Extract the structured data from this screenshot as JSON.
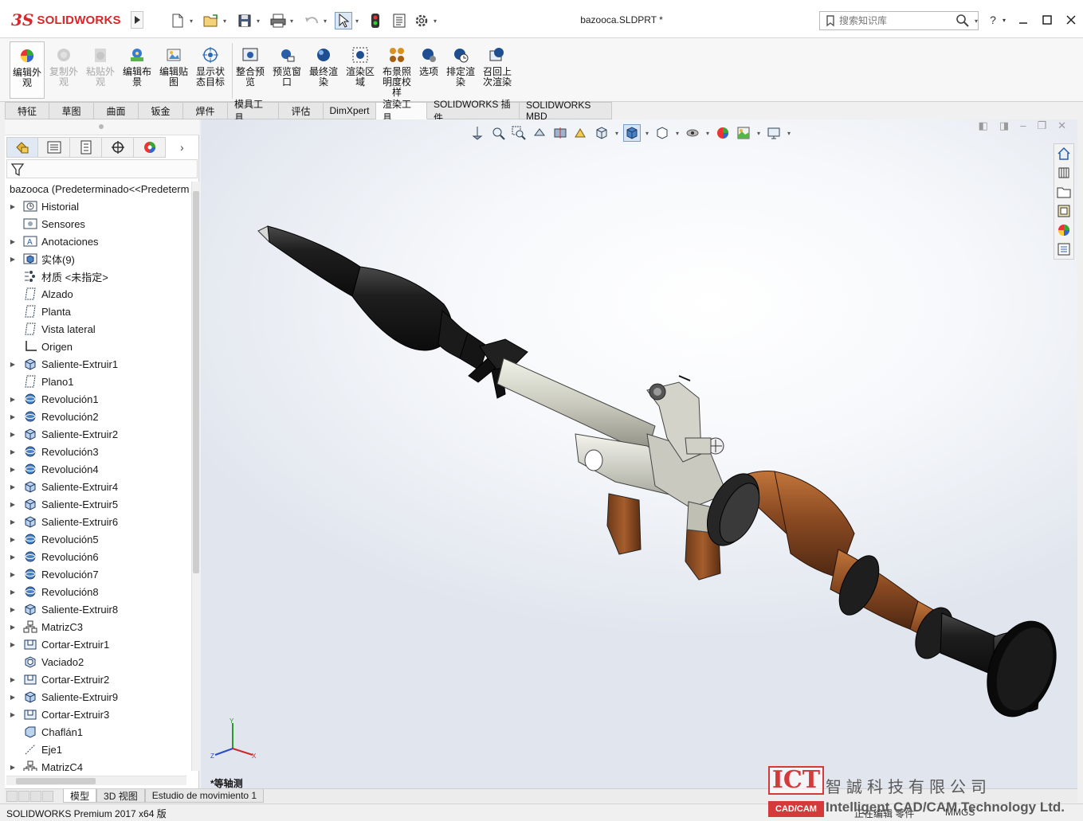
{
  "app": {
    "brand_mark": "3S",
    "brand_name": "SOLIDWORKS",
    "document_title": "bazooca.SLDPRT *",
    "search_placeholder": "搜索知识库",
    "help_label": "?"
  },
  "quick_access": [
    {
      "icon": "new-document-icon"
    },
    {
      "icon": "open-folder-icon"
    },
    {
      "icon": "save-icon"
    },
    {
      "icon": "print-icon"
    },
    {
      "icon": "undo-icon"
    },
    {
      "icon": "select-arrow-icon"
    },
    {
      "icon": "rebuild-traffic-light-icon"
    },
    {
      "icon": "file-properties-icon"
    },
    {
      "icon": "options-gear-icon"
    }
  ],
  "ribbon": {
    "buttons": [
      {
        "label": "编辑外观",
        "icon": "edit-appearance-icon",
        "enabled": true
      },
      {
        "label": "复制外观",
        "icon": "copy-appearance-icon",
        "enabled": false
      },
      {
        "label": "粘贴外观",
        "icon": "paste-appearance-icon",
        "enabled": false
      },
      {
        "label": "编辑布景",
        "icon": "edit-scene-icon",
        "enabled": true
      },
      {
        "label": "编辑贴图",
        "icon": "edit-decal-icon",
        "enabled": true
      },
      {
        "label": "显示状态目标",
        "icon": "display-state-target-icon",
        "enabled": true
      },
      {
        "label": "整合预览",
        "icon": "integrated-preview-icon",
        "enabled": true
      },
      {
        "label": "预览窗口",
        "icon": "preview-window-icon",
        "enabled": true
      },
      {
        "label": "最终渲染",
        "icon": "final-render-icon",
        "enabled": true
      },
      {
        "label": "渲染区域",
        "icon": "render-region-icon",
        "enabled": true
      },
      {
        "label": "布景照明度校样",
        "icon": "scene-illumination-proof-icon",
        "enabled": true
      },
      {
        "label": "选项",
        "icon": "options-icon",
        "enabled": true
      },
      {
        "label": "排定渲染",
        "icon": "schedule-render-icon",
        "enabled": true
      },
      {
        "label": "召回上次渲染",
        "icon": "recall-last-render-icon",
        "enabled": true
      }
    ]
  },
  "command_tabs": [
    "特征",
    "草图",
    "曲面",
    "钣金",
    "焊件",
    "模具工具",
    "评估",
    "DimXpert",
    "渲染工具",
    "SOLIDWORKS 插件",
    "SOLIDWORKS MBD"
  ],
  "active_command_tab": "渲染工具",
  "feature_tree": {
    "root": "bazooca  (Predeterminado<<Predeterminado>",
    "items": [
      {
        "label": "Historial",
        "icon": "history-icon",
        "expandable": true
      },
      {
        "label": "Sensores",
        "icon": "sensor-icon",
        "expandable": false
      },
      {
        "label": "Anotaciones",
        "icon": "annotation-icon",
        "expandable": true
      },
      {
        "label": "实体(9)",
        "icon": "solid-bodies-icon",
        "expandable": true
      },
      {
        "label": "材质 <未指定>",
        "icon": "material-icon",
        "expandable": false
      },
      {
        "label": "Alzado",
        "icon": "plane-icon",
        "expandable": false
      },
      {
        "label": "Planta",
        "icon": "plane-icon",
        "expandable": false
      },
      {
        "label": "Vista lateral",
        "icon": "plane-icon",
        "expandable": false
      },
      {
        "label": "Origen",
        "icon": "origin-icon",
        "expandable": false
      },
      {
        "label": "Saliente-Extruir1",
        "icon": "extrude-icon",
        "expandable": true
      },
      {
        "label": "Plano1",
        "icon": "plane-icon",
        "expandable": false
      },
      {
        "label": "Revolución1",
        "icon": "revolve-icon",
        "expandable": true
      },
      {
        "label": "Revolución2",
        "icon": "revolve-icon",
        "expandable": true
      },
      {
        "label": "Saliente-Extruir2",
        "icon": "extrude-icon",
        "expandable": true
      },
      {
        "label": "Revolución3",
        "icon": "revolve-icon",
        "expandable": true
      },
      {
        "label": "Revolución4",
        "icon": "revolve-icon",
        "expandable": true
      },
      {
        "label": "Saliente-Extruir4",
        "icon": "extrude-icon",
        "expandable": true
      },
      {
        "label": "Saliente-Extruir5",
        "icon": "extrude-icon",
        "expandable": true
      },
      {
        "label": "Saliente-Extruir6",
        "icon": "extrude-icon",
        "expandable": true
      },
      {
        "label": "Revolución5",
        "icon": "revolve-icon",
        "expandable": true
      },
      {
        "label": "Revolución6",
        "icon": "revolve-icon",
        "expandable": true
      },
      {
        "label": "Revolución7",
        "icon": "revolve-icon",
        "expandable": true
      },
      {
        "label": "Revolución8",
        "icon": "revolve-icon",
        "expandable": true
      },
      {
        "label": "Saliente-Extruir8",
        "icon": "extrude-icon",
        "expandable": true
      },
      {
        "label": "MatrizC3",
        "icon": "pattern-icon",
        "expandable": true
      },
      {
        "label": "Cortar-Extruir1",
        "icon": "cut-extrude-icon",
        "expandable": true
      },
      {
        "label": "Vaciado2",
        "icon": "shell-icon",
        "expandable": false
      },
      {
        "label": "Cortar-Extruir2",
        "icon": "cut-extrude-icon",
        "expandable": true
      },
      {
        "label": "Saliente-Extruir9",
        "icon": "extrude-icon",
        "expandable": true
      },
      {
        "label": "Cortar-Extruir3",
        "icon": "cut-extrude-icon",
        "expandable": true
      },
      {
        "label": "Chaflán1",
        "icon": "chamfer-icon",
        "expandable": false
      },
      {
        "label": "Eje1",
        "icon": "axis-icon",
        "expandable": false
      },
      {
        "label": "MatrizC4",
        "icon": "pattern-icon",
        "expandable": true
      }
    ]
  },
  "viewport": {
    "view_name": "*等轴测",
    "model": "bazooka (RPG launcher) with warhead, grey barrel, sights, wooden grip and bell",
    "colors": {
      "warhead": "#1b1b1b",
      "barrel": "#c8c9bc",
      "wood": "#8a4a22",
      "rings": "#1e1e1e"
    }
  },
  "bottom_tabs": [
    "模型",
    "3D 视图",
    "Estudio de movimiento 1"
  ],
  "active_bottom_tab": "模型",
  "status": {
    "product": "SOLIDWORKS Premium 2017 x64 版",
    "mode": "正在编辑 零件",
    "units": "MMGS"
  },
  "watermark": {
    "logo": "ICT",
    "logo_sub": "CAD/CAM",
    "company_cn": "智誠科技有限公司",
    "company_en": "Intelligent CAD/CAM Technology Ltd."
  }
}
